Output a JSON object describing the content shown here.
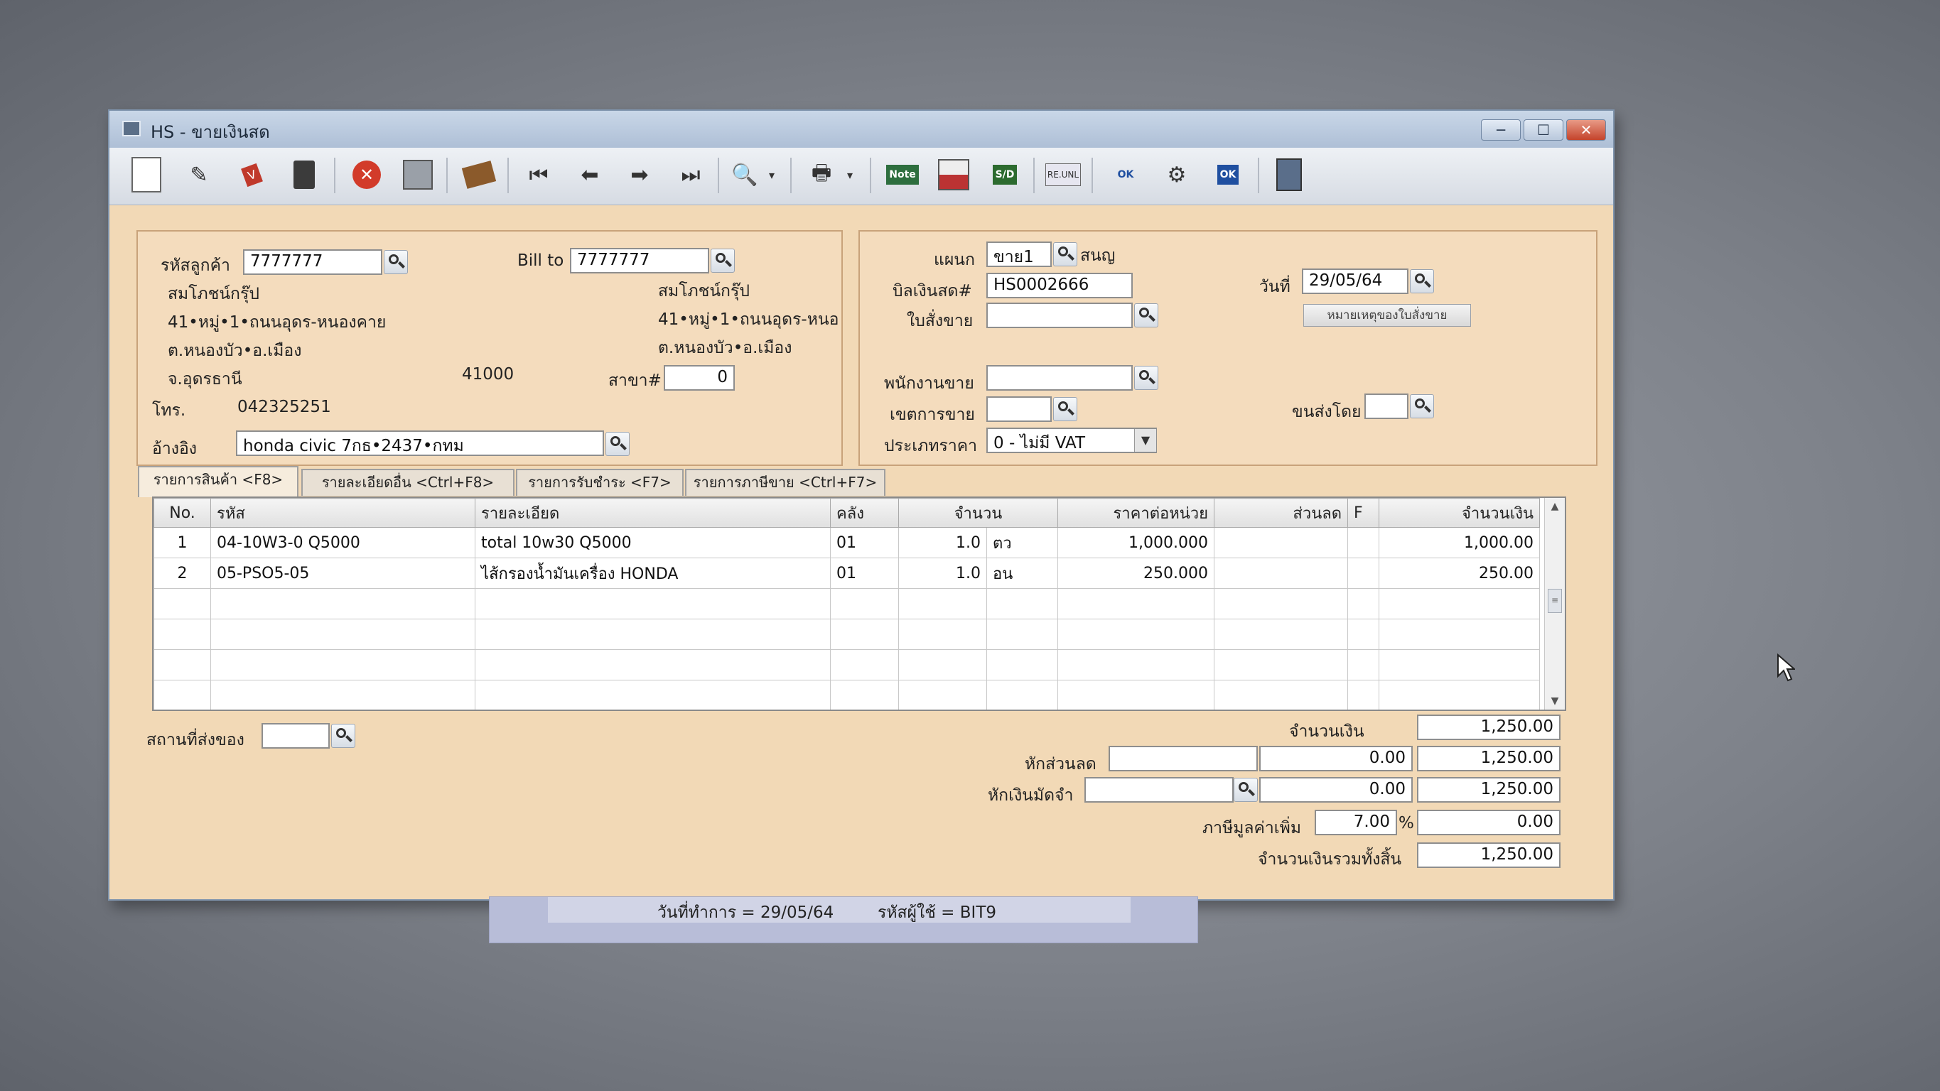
{
  "window": {
    "title": "HS - ขายเงินสด",
    "buttons": {
      "minimize": "─",
      "maximize": "☐",
      "close": "✕"
    }
  },
  "toolbar": {
    "icons": [
      "new-document-icon",
      "edit-icon",
      "void-icon",
      "delete-icon",
      "cancel-icon",
      "save-icon",
      "transfer-icon",
      "first-record-icon",
      "previous-record-icon",
      "next-record-icon",
      "last-record-icon",
      "search-icon",
      "dropdown-icon",
      "print-icon",
      "dropdown-icon",
      "note-icon",
      "form-icon",
      "sd-icon",
      "reunl-icon",
      "ok-stamp-icon",
      "link-icon",
      "ok-document-icon",
      "calculator-icon"
    ],
    "labels": {
      "note": "Note",
      "sd": "S/D",
      "reunl": "RE.UNL",
      "ok": "OK"
    }
  },
  "customer": {
    "code_label": "รหัสลูกค้า",
    "code_value": "7777777",
    "bill_to_label": "Bill to",
    "bill_to_value": "7777777",
    "name": "สมโภชน์กรุ๊ป",
    "address1": "41•หมู่•1•ถนนอุดร-หนองคาย",
    "address2": "ต.หนองบัว•อ.เมือง",
    "address3": "จ.อุดรธานี",
    "zip": "41000",
    "bill_name": "สมโภชน์กรุ๊ป",
    "bill_address1": "41•หมู่•1•ถนนอุดร-หนอ",
    "bill_address2": "ต.หนองบัว•อ.เมือง",
    "branch_label": "สาขา#",
    "branch_value": "0",
    "phone_label": "โทร.",
    "phone_value": "042325251",
    "ref_label": "อ้างอิง",
    "ref_value": "honda civic 7กธ•2437•กทม"
  },
  "document": {
    "dept_label": "แผนก",
    "dept_value": "ขาย1",
    "dept_name": "สนญ",
    "bill_no_label": "บิลเงินสด#",
    "bill_no_value": "HS0002666",
    "date_label": "วันที่",
    "date_value": "29/05/64",
    "order_label": "ใบสั่งขาย",
    "order_value": "",
    "order_note_button": "หมายเหตุของใบสั่งขาย",
    "salesman_label": "พนักงานขาย",
    "salesman_value": "",
    "area_label": "เขตการขาย",
    "area_value": "",
    "ship_by_label": "ขนส่งโดย",
    "ship_by_value": "",
    "price_type_label": "ประเภทราคา",
    "price_type_value": "0 - ไม่มี VAT"
  },
  "tabs": [
    "รายการสินค้า <F8>",
    "รายละเอียดอื่น <Ctrl+F8>",
    "รายการรับชำระ <F7>",
    "รายการภาษีขาย <Ctrl+F7>"
  ],
  "grid": {
    "headers": [
      "No.",
      "รหัส",
      "รายละเอียด",
      "คลัง",
      "จำนวน",
      "ราคาต่อหน่วย",
      "ส่วนลด",
      "F",
      "จำนวนเงิน"
    ],
    "rows": [
      {
        "no": "1",
        "code": "04-10W3-0 Q5000",
        "desc": "total 10w30 Q5000",
        "wh": "01",
        "qty": "1.0",
        "unit": "ตว",
        "price": "1,000.000",
        "disc": "",
        "f": "",
        "amount": "1,000.00"
      },
      {
        "no": "2",
        "code": "05-PSO5-05",
        "desc": "ไส้กรองน้ำมันเครื่อง HONDA",
        "wh": "01",
        "qty": "1.0",
        "unit": "อน",
        "price": "250.000",
        "disc": "",
        "f": "",
        "amount": "250.00"
      }
    ]
  },
  "footer": {
    "ship_place_label": "สถานที่ส่งของ",
    "ship_place_value": "",
    "amount_label": "จำนวนเงิน",
    "amount_value": "1,250.00",
    "discount_label": "หักส่วนลด",
    "discount_input": "",
    "discount_value": "0.00",
    "discount_total": "1,250.00",
    "deposit_label": "หักเงินมัดจำ",
    "deposit_input": "",
    "deposit_value": "0.00",
    "deposit_total": "1,250.00",
    "vat_label": "ภาษีมูลค่าเพิ่ม",
    "vat_rate": "7.00",
    "vat_pct": "%",
    "vat_value": "0.00",
    "grand_total_label": "จำนวนเงินรวมทั้งสิ้น",
    "grand_total_value": "1,250.00"
  },
  "status": {
    "work_date": "วันที่ทำการ  =  29/05/64",
    "user": "รหัสผู้ใช้  =  BIT9"
  },
  "colors": {
    "form_bg": "#f2d9b6",
    "titlebar": "#b8c8dd",
    "close": "#c4432b"
  }
}
